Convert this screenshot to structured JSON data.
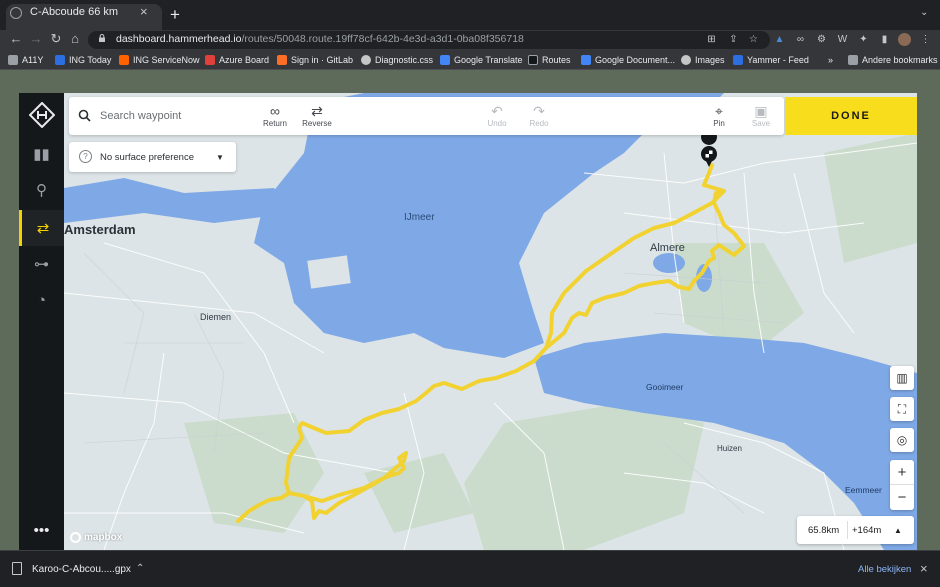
{
  "browser": {
    "tab_title": "C-Abcoude 66 km",
    "url_host": "dashboard.hammerhead.io",
    "url_path": "/routes/50048.route.19ff78cf-642b-4e3d-a3d1-0ba08f356718",
    "bookmarks": [
      {
        "label": "A11Y",
        "color": "#9aa0a6"
      },
      {
        "label": "ING Today",
        "color": "#2c6fe0"
      },
      {
        "label": "ING ServiceNow",
        "color": "#ff6200"
      },
      {
        "label": "Azure Board",
        "color": "#e0403a"
      },
      {
        "label": "Sign in · GitLab",
        "color": "#fc6d26"
      },
      {
        "label": "Diagnostic.css",
        "color": "#c4c7c5"
      },
      {
        "label": "Google Translate",
        "color": "#4285f4"
      },
      {
        "label": "Routes",
        "color": "#15181b"
      },
      {
        "label": "Google Document...",
        "color": "#4285f4"
      },
      {
        "label": "Images",
        "color": "#c4c7c5"
      },
      {
        "label": "Yammer - Feed",
        "color": "#2c6fe0"
      }
    ],
    "bookmarks_more": "»",
    "bookmarks_other": "Andere bookmarks"
  },
  "toolbar": {
    "search_placeholder": "Search waypoint",
    "return_label": "Return",
    "reverse_label": "Reverse",
    "undo_label": "Undo",
    "redo_label": "Redo",
    "pin_label": "Pin",
    "save_label": "Save",
    "done_label": "DONE"
  },
  "surface": {
    "selected": "No surface preference"
  },
  "map": {
    "labels": {
      "ijmeer": "IJmeer",
      "amsterdam": "Amsterdam",
      "almere": "Almere",
      "diemen": "Diemen",
      "gooimeer": "Gooimeer",
      "huizen": "Huizen",
      "eemmeer": "Eemmeer"
    },
    "attribution": "mapbox",
    "water_color": "#7fa9e6",
    "land_color": "#dde5e8",
    "route_color": "#f2d231"
  },
  "stats": {
    "distance": "65.8km",
    "elevation": "+164m"
  },
  "downloads": {
    "file_name": "Karoo-C-Abcou.....gpx",
    "show_all": "Alle bekijken"
  },
  "accent_color": "#f8dd1d"
}
